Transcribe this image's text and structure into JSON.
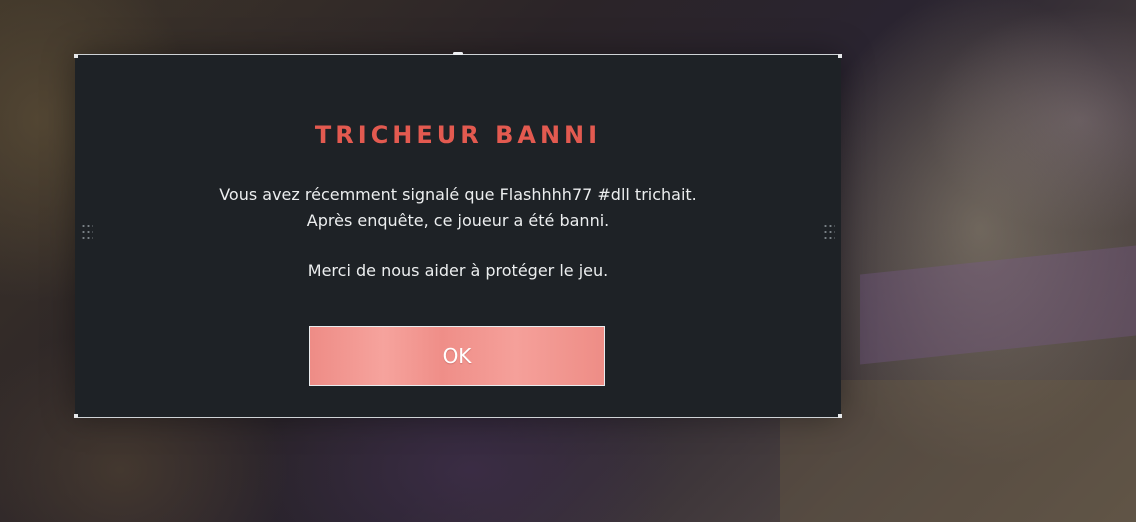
{
  "dialog": {
    "title": "TRICHEUR BANNI",
    "message_line_1": "Vous avez récemment signalé que Flashhhh77 #dll trichait.",
    "message_line_2": "Après enquête, ce joueur a été banni.",
    "message_line_3": "Merci de nous aider à protéger le jeu.",
    "ok_label": "OK"
  },
  "colors": {
    "title": "#e35a50",
    "panel_background": "#1e2226",
    "button_background": "#ef8e88",
    "text": "#eceeef"
  }
}
